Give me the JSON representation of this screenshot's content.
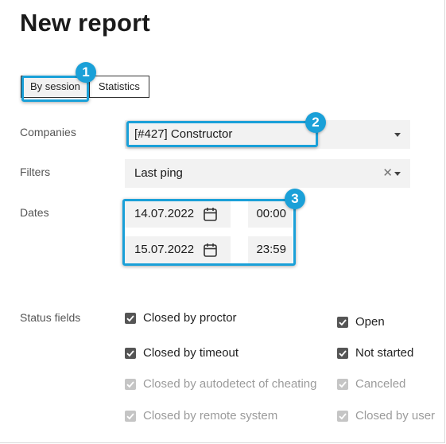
{
  "page": {
    "title": "New report"
  },
  "tabs": [
    {
      "label": "By session",
      "active": true
    },
    {
      "label": "Statistics",
      "active": false
    }
  ],
  "callouts": [
    "1",
    "2",
    "3"
  ],
  "form": {
    "companies": {
      "label": "Companies",
      "value": "[#427] Constructor"
    },
    "filters": {
      "label": "Filters",
      "value": "Last ping"
    },
    "dates": {
      "label": "Dates",
      "start_date": "14.07.2022",
      "start_time": "00:00",
      "end_date": "15.07.2022",
      "end_time": "23:59"
    },
    "status_fields": {
      "label": "Status fields",
      "left": [
        {
          "label": "Closed by proctor",
          "checked": true,
          "disabled": false
        },
        {
          "label": "Closed by timeout",
          "checked": true,
          "disabled": false
        },
        {
          "label": "Closed by autodetect of cheating",
          "checked": true,
          "disabled": true
        },
        {
          "label": "Closed by remote system",
          "checked": true,
          "disabled": true
        }
      ],
      "right": [
        {
          "label": "Open",
          "checked": true,
          "disabled": false
        },
        {
          "label": "Not started",
          "checked": true,
          "disabled": false
        },
        {
          "label": "Canceled",
          "checked": true,
          "disabled": true
        },
        {
          "label": "Closed by user",
          "checked": true,
          "disabled": true
        }
      ]
    }
  },
  "colors": {
    "accent": "#1aa0d8",
    "field_bg": "#f2f2f2",
    "checkbox": "#555555",
    "checkbox_disabled": "#c5c5c5"
  }
}
